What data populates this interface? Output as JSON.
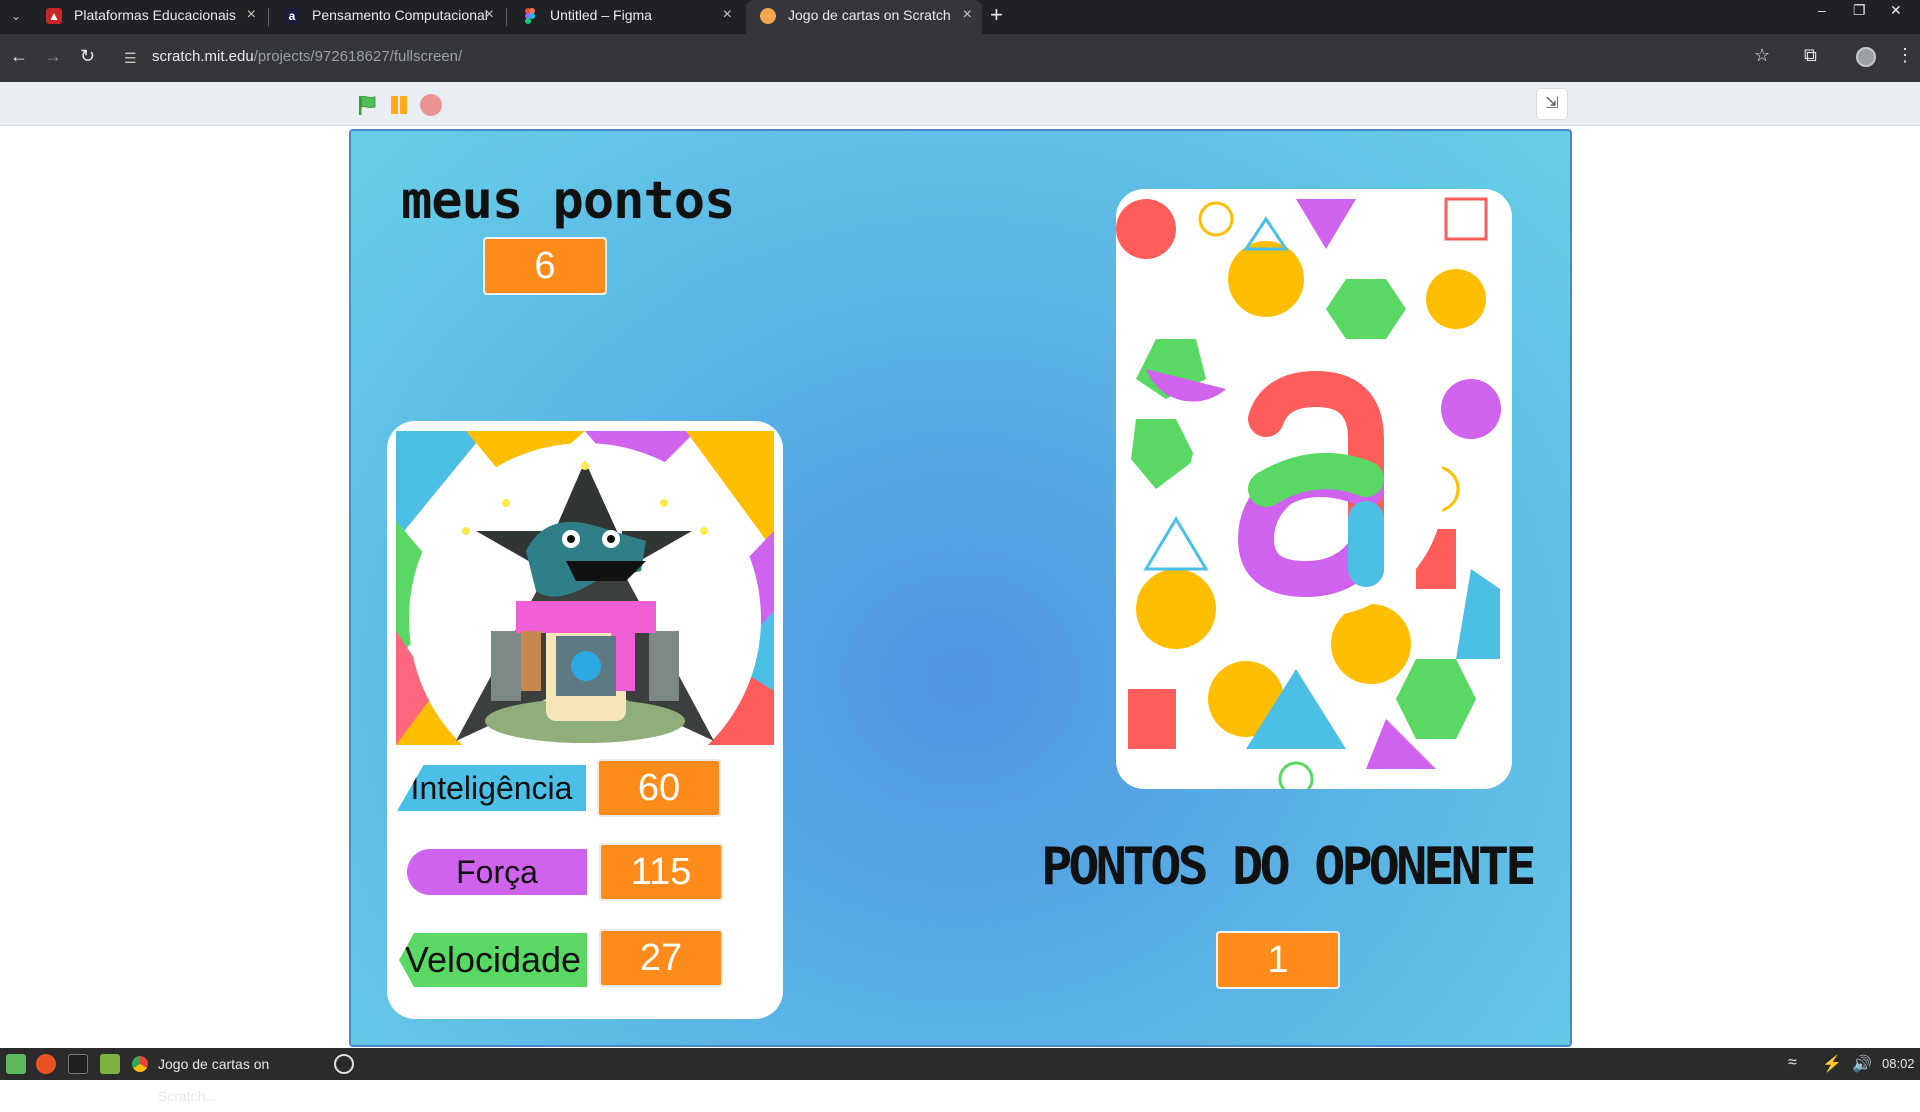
{
  "browser": {
    "tabs": [
      {
        "title": "Plataformas Educacionais",
        "icon": "tab-favicon-red",
        "active": false
      },
      {
        "title": "Pensamento Computacional",
        "icon": "tab-favicon-a",
        "active": false
      },
      {
        "title": "Untitled – Figma",
        "icon": "figma-icon",
        "active": false
      },
      {
        "title": "Jogo de cartas on Scratch",
        "icon": "scratch-icon",
        "active": true
      }
    ],
    "url_domain": "scratch.mit.edu",
    "url_path": "/projects/972618627/fullscreen/"
  },
  "stage": {
    "my_points_title": "meus pontos",
    "my_points": "6",
    "opponent_points_title": "PONTOS DO OPONENTE",
    "opponent_points": "1",
    "card": {
      "stats": [
        {
          "label": "Inteligência",
          "value": "60",
          "color": "#4cbfe6"
        },
        {
          "label": "Força",
          "value": "115",
          "color": "#cf63ed"
        },
        {
          "label": "Velocidade",
          "value": "27",
          "color": "#59d964"
        }
      ]
    },
    "opponent_card_letter": "a"
  },
  "taskbar": {
    "task_label": "Jogo de cartas on Scratch...",
    "clock": "08:02"
  },
  "colors": {
    "orange": "#ff8c1a",
    "scratch_green": "#4cbf56",
    "scratch_yellow": "#ffab19",
    "scratch_red": "#ec5959"
  }
}
